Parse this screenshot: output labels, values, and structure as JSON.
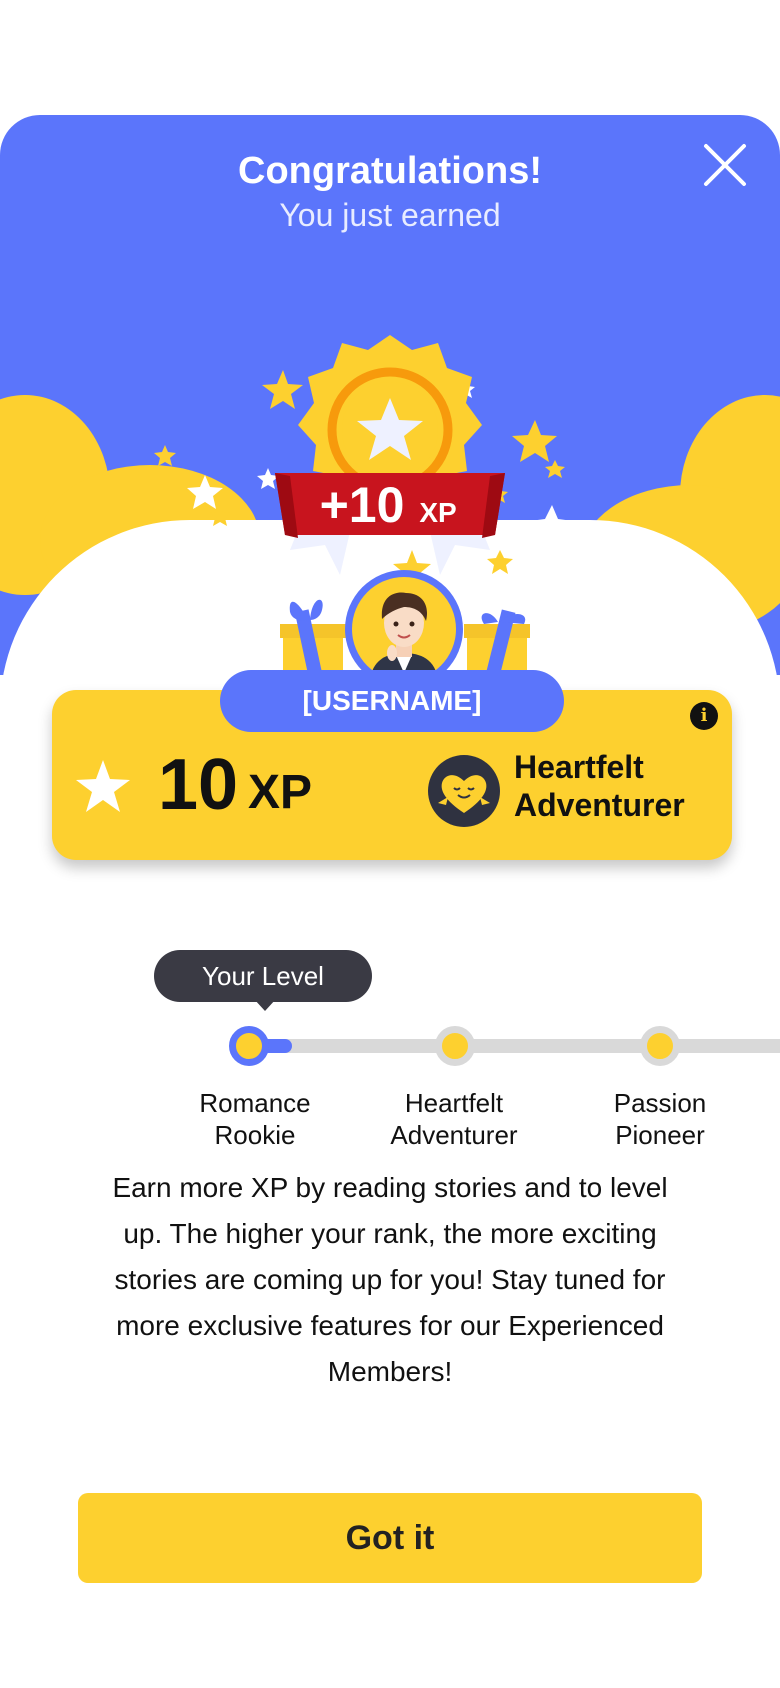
{
  "header": {
    "title": "Congratulations!",
    "subtitle": "You just earned",
    "reward_amount": "+10",
    "reward_unit": "XP"
  },
  "profile": {
    "username": "[USERNAME]"
  },
  "xp_card": {
    "xp_value": "10",
    "xp_unit": "XP",
    "rank_line1": "Heartfelt",
    "rank_line2": "Adventurer",
    "info_symbol": "i"
  },
  "levels": {
    "tooltip": "Your Level",
    "items": [
      {
        "line1": "Romance",
        "line2": "Rookie",
        "state": "current"
      },
      {
        "line1": "Heartfelt",
        "line2": "Adventurer",
        "state": "future"
      },
      {
        "line1": "Passion",
        "line2": "Pioneer",
        "state": "future"
      }
    ],
    "progress_in_current": 0.2
  },
  "description": "Earn more XP by reading stories and to level up. The higher your rank, the more exciting stories are coming up for you! Stay tuned for more exclusive features for our Experienced Members!",
  "button": {
    "label": "Got it"
  },
  "colors": {
    "primary_blue": "#5b75fb",
    "accent_yellow": "#fdd02f",
    "badge_red": "#c8141e",
    "track_gray": "#d9d9d9"
  },
  "icons": {
    "close": "close-icon",
    "info": "info-icon",
    "star": "star-icon",
    "rank": "heart-face-icon",
    "medal": "medal-badge-icon",
    "gift": "gift-icon"
  }
}
